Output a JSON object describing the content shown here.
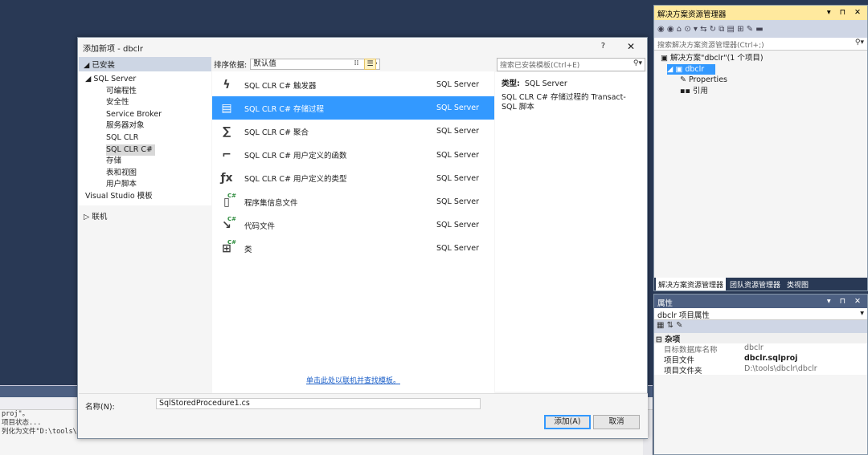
{
  "dialog": {
    "title": "添加新项 - dbclr",
    "help": "?",
    "close": "✕",
    "installed_header": "◢ 已安装",
    "tree": [
      {
        "label": "◢ SQL Server",
        "indent": 0
      },
      {
        "label": "可编程性",
        "indent": 1
      },
      {
        "label": "安全性",
        "indent": 1
      },
      {
        "label": "Service Broker",
        "indent": 1
      },
      {
        "label": "服务器对象",
        "indent": 1
      },
      {
        "label": "SQL CLR",
        "indent": 1
      },
      {
        "label": "SQL CLR C#",
        "indent": 1,
        "selected": true
      },
      {
        "label": "存储",
        "indent": 1
      },
      {
        "label": "表和视图",
        "indent": 1
      },
      {
        "label": "用户脚本",
        "indent": 1
      },
      {
        "label": "Visual Studio 模板",
        "indent": 0
      }
    ],
    "online": "▷ 联机",
    "sort_label": "排序依据:",
    "sort_value": "默认值",
    "search_placeholder": "搜索已安装模板(Ctrl+E)",
    "templates": [
      {
        "name": "SQL CLR C# 触发器",
        "category": "SQL Server",
        "icon": "ϟ",
        "badge": ""
      },
      {
        "name": "SQL CLR C# 存储过程",
        "category": "SQL Server",
        "icon": "▤",
        "badge": "",
        "selected": true
      },
      {
        "name": "SQL CLR C# 聚合",
        "category": "SQL Server",
        "icon": "∑",
        "badge": ""
      },
      {
        "name": "SQL CLR C# 用户定义的函数",
        "category": "SQL Server",
        "icon": "⌐",
        "badge": ""
      },
      {
        "name": "SQL CLR C# 用户定义的类型",
        "category": "SQL Server",
        "icon": "ƒx",
        "badge": ""
      },
      {
        "name": "程序集信息文件",
        "category": "SQL Server",
        "icon": "▯",
        "badge": "C#"
      },
      {
        "name": "代码文件",
        "category": "SQL Server",
        "icon": "↘",
        "badge": "C#"
      },
      {
        "name": "类",
        "category": "SQL Server",
        "icon": "⊞",
        "badge": "C#"
      }
    ],
    "online_link": "单击此处以联机并查找模板。",
    "type_label": "类型:",
    "type_value": "SQL Server",
    "description": "SQL CLR C# 存储过程的 Transact-SQL 脚本",
    "name_label": "名称(N):",
    "name_value": "SqlStoredProcedure1.cs",
    "add_button": "添加(A)",
    "cancel_button": "取消"
  },
  "solution_explorer": {
    "title": "解决方案资源管理器",
    "controls": "▾ ⊓ ✕",
    "toolbar": "◉ ◉ ⌂  ⊙ ▾ ⇆ ↻ ⧉ ▤ ⊞  ✎  ▬",
    "search_placeholder": "搜索解决方案资源管理器(Ctrl+;)",
    "nodes": [
      {
        "label": "▣ 解决方案\"dbclr\"(1 个项目)",
        "indent": 0
      },
      {
        "label": "◢ ▣ dbclr",
        "indent": 1,
        "selected": true
      },
      {
        "label": "✎ Properties",
        "indent": 3
      },
      {
        "label": "▪▪ 引用",
        "indent": 3
      }
    ],
    "tabs": [
      "解决方案资源管理器",
      "团队资源管理器",
      "类视图"
    ]
  },
  "properties": {
    "title": "属性",
    "controls": "▾ ⊓ ✕",
    "object": "dbclr 项目属性",
    "toolbar": "▦ ⇅ ✎",
    "category": "⊟ 杂项",
    "rows": [
      {
        "k": "目标数据库名称",
        "v": "dbclr",
        "style": "gray"
      },
      {
        "k": "项目文件",
        "v": "dbclr.sqlproj",
        "style": "dark"
      },
      {
        "k": "项目文件夹",
        "v": "D:\\tools\\dbclr\\dbclr",
        "style": "plain"
      }
    ]
  },
  "output": {
    "lines": [
      "proj\"。",
      "项目状态...",
      "列化为文件\"D:\\tools\\dbclr\\dbclr\\dbclr.dbmdl\"。"
    ]
  }
}
